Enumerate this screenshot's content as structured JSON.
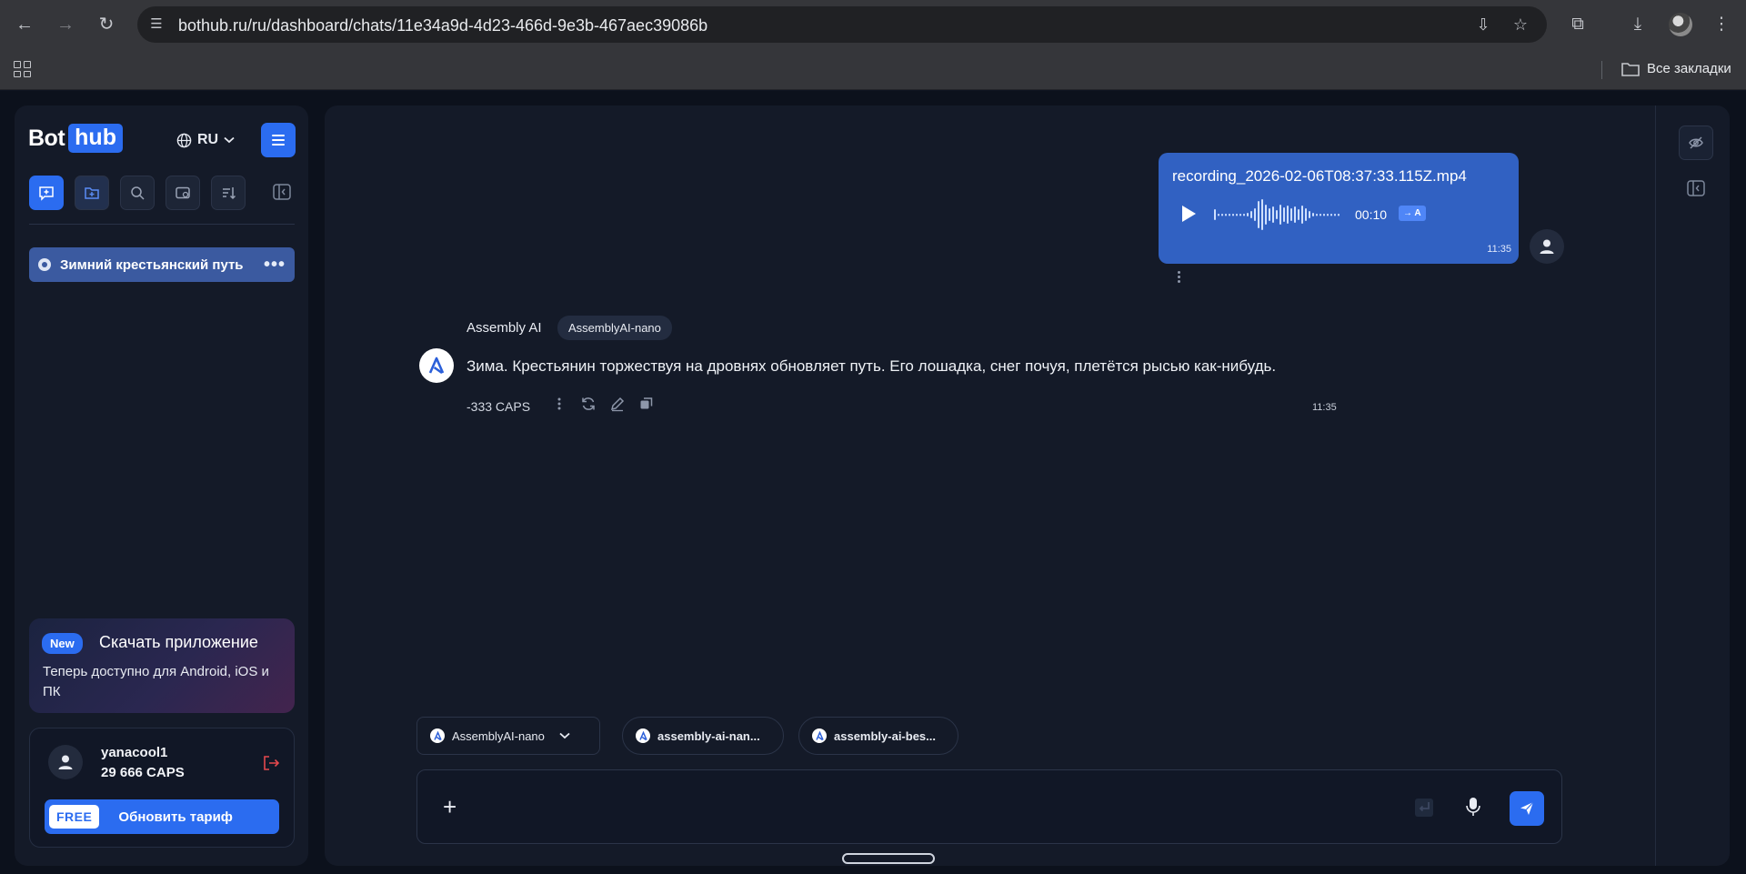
{
  "browser": {
    "url": "bothub.ru/ru/dashboard/chats/11e34a9d-4d23-466d-9e3b-467aec39086b",
    "bookmarks_label": "Все закладки"
  },
  "sidebar": {
    "logo_bot": "Bot",
    "logo_hub": "hub",
    "language": "RU",
    "chats": [
      {
        "title": "Зимний крестьянский путь",
        "active": true
      }
    ],
    "promo": {
      "badge": "New",
      "title": "Скачать приложение",
      "text": "Теперь доступно для Android, iOS и ПК"
    },
    "user": {
      "name": "yanacool1",
      "caps": "29 666 CAPS",
      "plan": "FREE",
      "upgrade_label": "Обновить тариф"
    }
  },
  "chat": {
    "user_message": {
      "filename": "recording_2026-02-06T08:37:33.115Z.mp4",
      "duration": "00:10",
      "transcribe_badge": "→ A",
      "time": "11:35"
    },
    "bot_message": {
      "name": "Assembly AI",
      "model": "AssemblyAI-nano",
      "text": "Зима. Крестьянин торжествуя на дровнях обновляет путь. Его лошадка, снег почуя, плетётся рысью как-нибудь.",
      "cost": "-333 CAPS",
      "time": "11:35"
    }
  },
  "composer": {
    "model_selector": "AssemblyAI-nano",
    "suggested_models": [
      "assembly-ai-nan...",
      "assembly-ai-bes..."
    ]
  },
  "colors": {
    "accent": "#2b6cf0",
    "user_bubble": "#3161c2",
    "panel": "#141a28",
    "background": "#0c111c"
  }
}
